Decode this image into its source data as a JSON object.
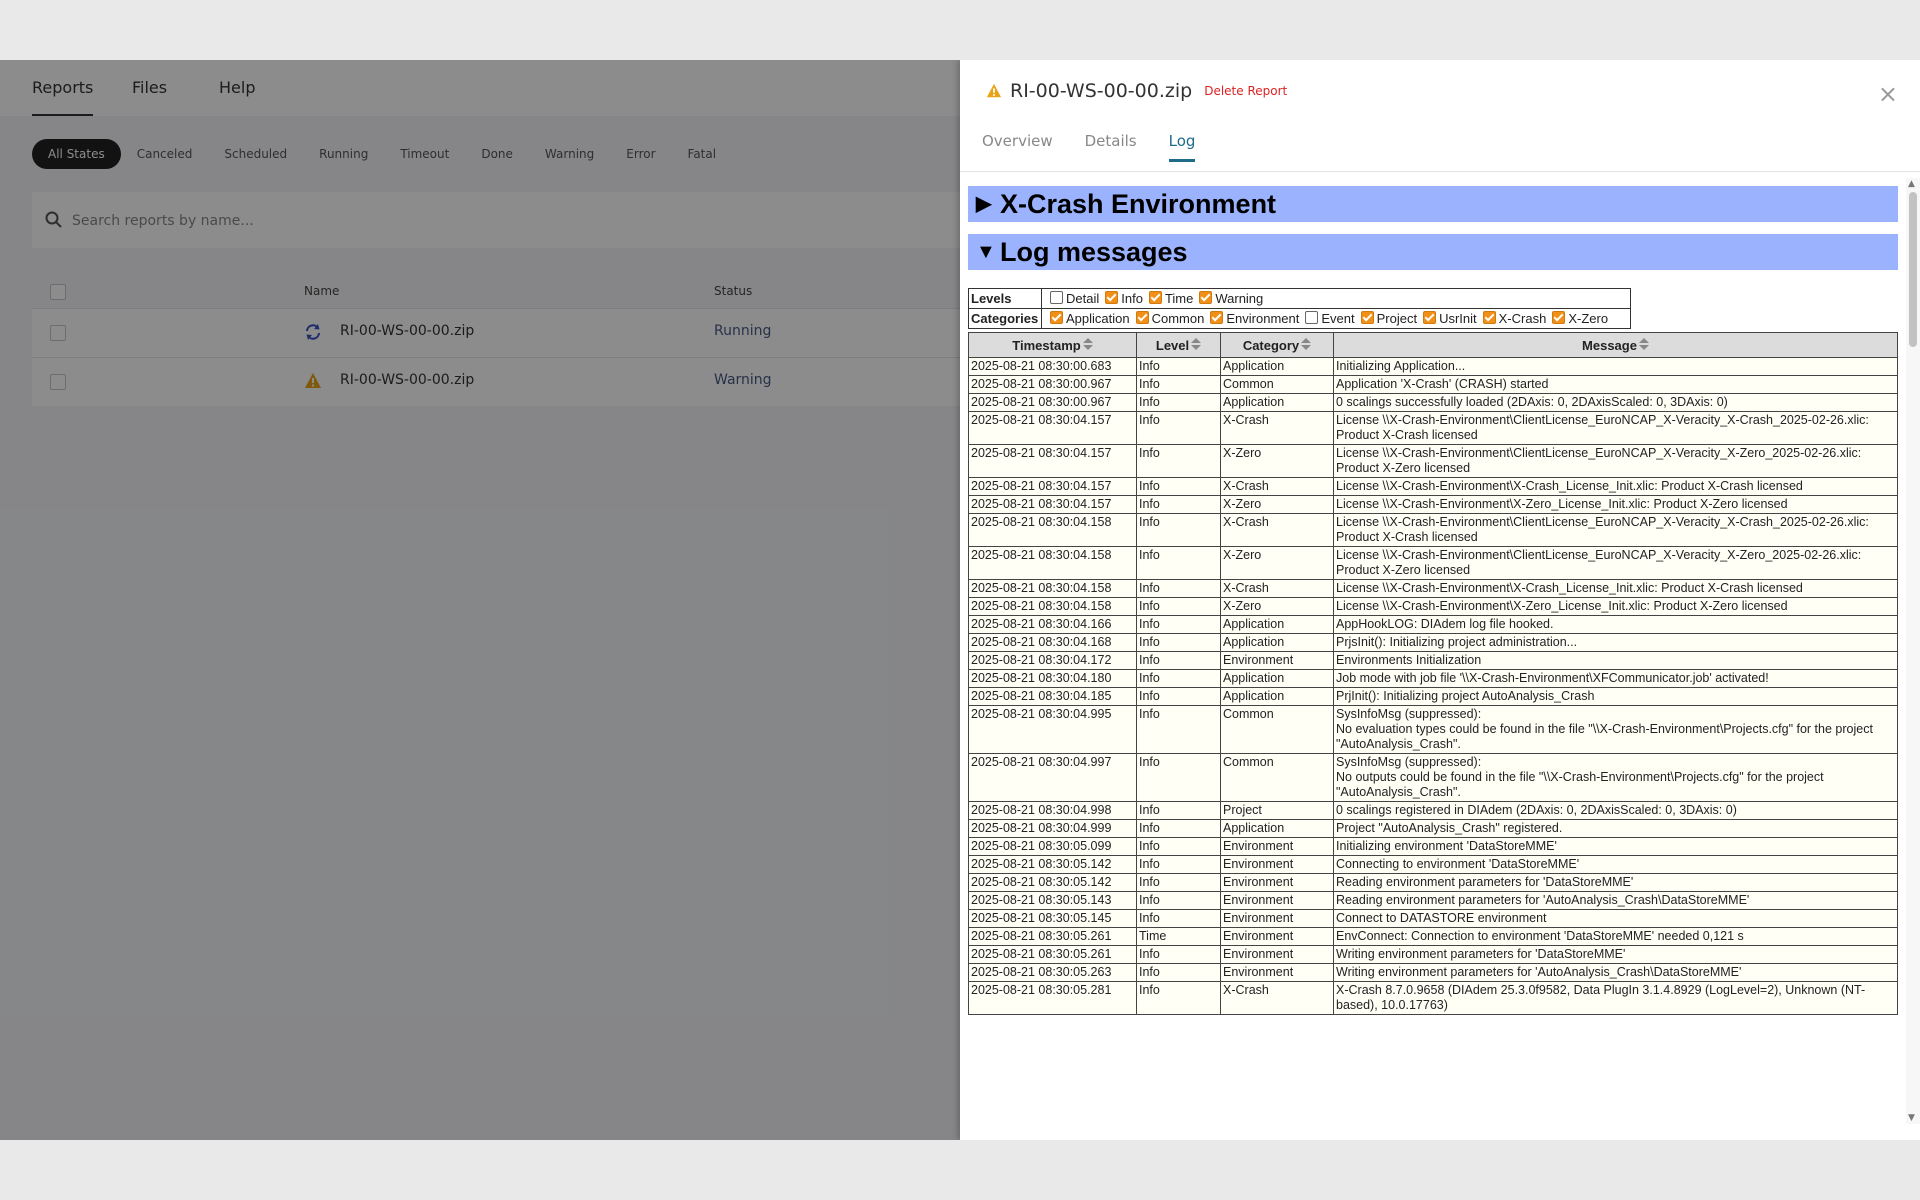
{
  "app": {
    "nav_tabs": [
      "Reports",
      "Files",
      "Help"
    ],
    "filters": [
      "All States",
      "Canceled",
      "Scheduled",
      "Running",
      "Timeout",
      "Done",
      "Warning",
      "Error",
      "Fatal"
    ],
    "search_placeholder": "Search reports by name...",
    "columns": {
      "name": "Name",
      "status": "Status"
    },
    "rows": [
      {
        "name": "RI-00-WS-00-00.zip",
        "status": "Running",
        "icon": "sync-icon"
      },
      {
        "name": "RI-00-WS-00-00.zip",
        "status": "Warning",
        "icon": "warning-icon"
      }
    ],
    "colors": {
      "status_text": "#4a5a86",
      "sync_icon": "#3a53c5",
      "warning_icon": "#e8a317"
    }
  },
  "drawer": {
    "title": "RI-00-WS-00-00.zip",
    "delete_label": "Delete Report",
    "close_symbol": "×",
    "tabs": [
      "Overview",
      "Details",
      "Log"
    ],
    "active_tab": "Log",
    "colors": {
      "accent": "#1f6b8a",
      "section_bg": "#9bb3ff",
      "delete": "#dd2222"
    }
  },
  "log": {
    "sections": [
      {
        "title": "X-Crash Environment",
        "expanded": false
      },
      {
        "title": "Log messages",
        "expanded": true
      }
    ],
    "levels_label": "Levels",
    "categories_label": "Categories",
    "levels": [
      {
        "label": "Detail",
        "checked": false
      },
      {
        "label": "Info",
        "checked": true
      },
      {
        "label": "Time",
        "checked": true
      },
      {
        "label": "Warning",
        "checked": true
      }
    ],
    "categories": [
      {
        "label": "Application",
        "checked": true
      },
      {
        "label": "Common",
        "checked": true
      },
      {
        "label": "Environment",
        "checked": true
      },
      {
        "label": "Event",
        "checked": false
      },
      {
        "label": "Project",
        "checked": true
      },
      {
        "label": "UsrInit",
        "checked": true
      },
      {
        "label": "X-Crash",
        "checked": true
      },
      {
        "label": "X-Zero",
        "checked": true
      }
    ],
    "columns": [
      "Timestamp",
      "Level",
      "Category",
      "Message"
    ],
    "entries": [
      [
        "2025-08-21 08:30:00.683",
        "Info",
        "Application",
        "Initializing Application..."
      ],
      [
        "2025-08-21 08:30:00.967",
        "Info",
        "Common",
        "Application 'X-Crash' (CRASH) started"
      ],
      [
        "2025-08-21 08:30:00.967",
        "Info",
        "Application",
        "0 scalings successfully loaded (2DAxis: 0, 2DAxisScaled: 0, 3DAxis: 0)"
      ],
      [
        "2025-08-21 08:30:04.157",
        "Info",
        "X-Crash",
        "License \\\\X-Crash-Environment\\ClientLicense_EuroNCAP_X-Veracity_X-Crash_2025-02-26.xlic: Product X-Crash licensed"
      ],
      [
        "2025-08-21 08:30:04.157",
        "Info",
        "X-Zero",
        "License \\\\X-Crash-Environment\\ClientLicense_EuroNCAP_X-Veracity_X-Zero_2025-02-26.xlic: Product X-Zero licensed"
      ],
      [
        "2025-08-21 08:30:04.157",
        "Info",
        "X-Crash",
        "License \\\\X-Crash-Environment\\X-Crash_License_Init.xlic: Product X-Crash licensed"
      ],
      [
        "2025-08-21 08:30:04.157",
        "Info",
        "X-Zero",
        "License \\\\X-Crash-Environment\\X-Zero_License_Init.xlic: Product X-Zero licensed"
      ],
      [
        "2025-08-21 08:30:04.158",
        "Info",
        "X-Crash",
        "License \\\\X-Crash-Environment\\ClientLicense_EuroNCAP_X-Veracity_X-Crash_2025-02-26.xlic: Product X-Crash licensed"
      ],
      [
        "2025-08-21 08:30:04.158",
        "Info",
        "X-Zero",
        "License \\\\X-Crash-Environment\\ClientLicense_EuroNCAP_X-Veracity_X-Zero_2025-02-26.xlic: Product X-Zero licensed"
      ],
      [
        "2025-08-21 08:30:04.158",
        "Info",
        "X-Crash",
        "License \\\\X-Crash-Environment\\X-Crash_License_Init.xlic: Product X-Crash licensed"
      ],
      [
        "2025-08-21 08:30:04.158",
        "Info",
        "X-Zero",
        "License \\\\X-Crash-Environment\\X-Zero_License_Init.xlic: Product X-Zero licensed"
      ],
      [
        "2025-08-21 08:30:04.166",
        "Info",
        "Application",
        "AppHookLOG: DIAdem log file hooked."
      ],
      [
        "2025-08-21 08:30:04.168",
        "Info",
        "Application",
        "PrjsInit(): Initializing project administration..."
      ],
      [
        "2025-08-21 08:30:04.172",
        "Info",
        "Environment",
        "Environments Initialization"
      ],
      [
        "2025-08-21 08:30:04.180",
        "Info",
        "Application",
        "Job mode with job file '\\\\X-Crash-Environment\\XFCommunicator.job' activated!"
      ],
      [
        "2025-08-21 08:30:04.185",
        "Info",
        "Application",
        "PrjInit(): Initializing project AutoAnalysis_Crash"
      ],
      [
        "2025-08-21 08:30:04.995",
        "Info",
        "Common",
        "SysInfoMsg (suppressed):\nNo evaluation types could be found in the file \"\\\\X-Crash-Environment\\Projects.cfg\" for the project \"AutoAnalysis_Crash\"."
      ],
      [
        "2025-08-21 08:30:04.997",
        "Info",
        "Common",
        "SysInfoMsg (suppressed):\nNo outputs could be found in the file \"\\\\X-Crash-Environment\\Projects.cfg\" for the project \"AutoAnalysis_Crash\"."
      ],
      [
        "2025-08-21 08:30:04.998",
        "Info",
        "Project",
        "0 scalings registered in DIAdem (2DAxis: 0, 2DAxisScaled: 0, 3DAxis: 0)"
      ],
      [
        "2025-08-21 08:30:04.999",
        "Info",
        "Application",
        "Project \"AutoAnalysis_Crash\" registered."
      ],
      [
        "2025-08-21 08:30:05.099",
        "Info",
        "Environment",
        "Initializing environment 'DataStoreMME'"
      ],
      [
        "2025-08-21 08:30:05.142",
        "Info",
        "Environment",
        "Connecting to environment 'DataStoreMME'"
      ],
      [
        "2025-08-21 08:30:05.142",
        "Info",
        "Environment",
        "Reading environment parameters for 'DataStoreMME'"
      ],
      [
        "2025-08-21 08:30:05.143",
        "Info",
        "Environment",
        "Reading environment parameters for 'AutoAnalysis_Crash\\DataStoreMME'"
      ],
      [
        "2025-08-21 08:30:05.145",
        "Info",
        "Environment",
        "Connect to DATASTORE environment"
      ],
      [
        "2025-08-21 08:30:05.261",
        "Time",
        "Environment",
        "EnvConnect: Connection to environment 'DataStoreMME' needed 0,121 s"
      ],
      [
        "2025-08-21 08:30:05.261",
        "Info",
        "Environment",
        "Writing environment parameters for 'DataStoreMME'"
      ],
      [
        "2025-08-21 08:30:05.263",
        "Info",
        "Environment",
        "Writing environment parameters for 'AutoAnalysis_Crash\\DataStoreMME'"
      ],
      [
        "2025-08-21 08:30:05.281",
        "Info",
        "X-Crash",
        "X-Crash 8.7.0.9658 (DIAdem 25.3.0f9582, Data PlugIn 3.1.4.8929 (LogLevel=2), Unknown (NT-based), 10.0.17763)"
      ]
    ]
  }
}
